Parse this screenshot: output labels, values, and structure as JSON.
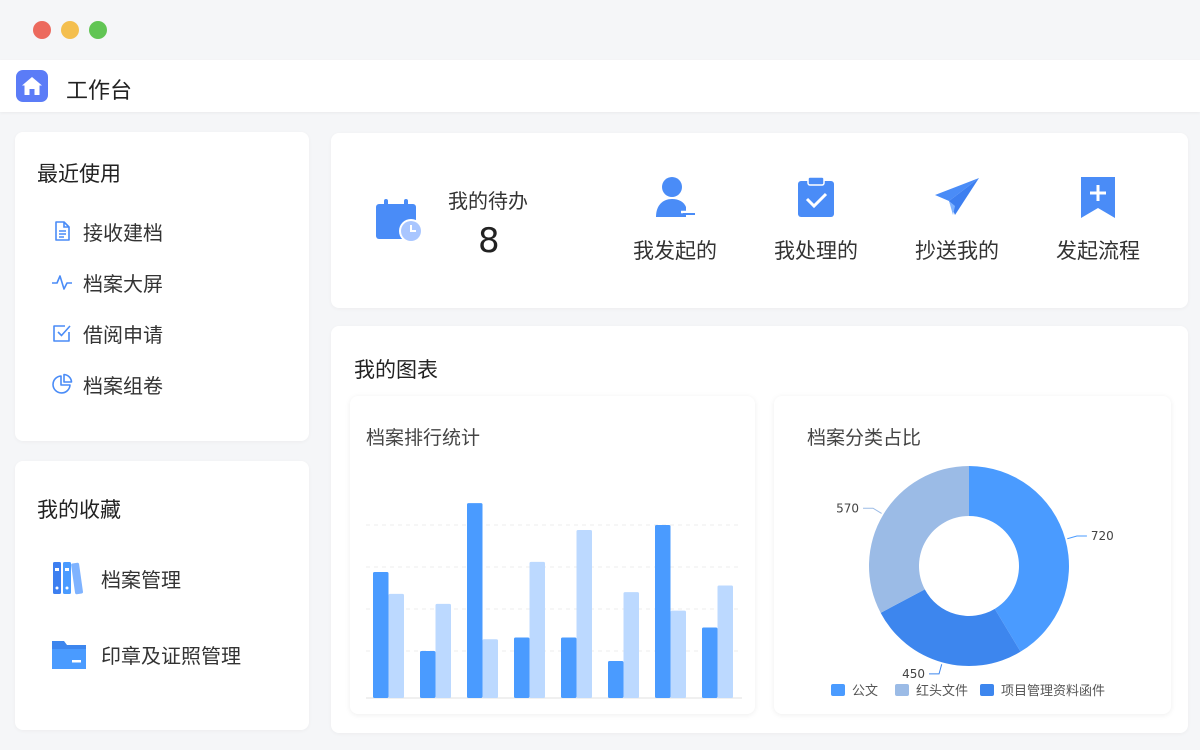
{
  "app": {
    "title": "工作台"
  },
  "recent": {
    "title": "最近使用",
    "items": [
      {
        "label": "接收建档",
        "icon": "document-icon"
      },
      {
        "label": "档案大屏",
        "icon": "pulse-icon"
      },
      {
        "label": "借阅申请",
        "icon": "checkbox-icon"
      },
      {
        "label": "档案组卷",
        "icon": "pie-icon"
      }
    ]
  },
  "favorites": {
    "title": "我的收藏",
    "items": [
      {
        "label": "档案管理",
        "icon": "binders-icon"
      },
      {
        "label": "印章及证照管理",
        "icon": "folder-icon"
      }
    ]
  },
  "todo": {
    "label": "我的待办",
    "count": "8",
    "actions": [
      {
        "label": "我发起的",
        "icon": "user-send-icon"
      },
      {
        "label": "我处理的",
        "icon": "clipboard-check-icon"
      },
      {
        "label": "抄送我的",
        "icon": "paper-plane-icon"
      },
      {
        "label": "发起流程",
        "icon": "bookmark-plus-icon"
      }
    ]
  },
  "charts": {
    "title": "我的图表",
    "accent": "#4a9bff",
    "accent_light": "#bcd9ff"
  },
  "chart_data": [
    {
      "type": "bar",
      "title": "档案排行统计",
      "categories": [
        "",
        "",
        "",
        "",
        "",
        "",
        "",
        ""
      ],
      "series": [
        {
          "values": [
            75,
            28,
            116,
            36,
            36,
            22,
            103,
            42
          ],
          "color": "#4a9bff"
        },
        {
          "values": [
            62,
            56,
            35,
            81,
            100,
            63,
            52,
            67
          ],
          "color": "#bcd9ff"
        }
      ],
      "ylim": [
        0,
        125
      ],
      "grid": true
    },
    {
      "type": "pie",
      "title": "档案分类占比",
      "donut": true,
      "slices": [
        {
          "name": "公文",
          "value": 720,
          "color": "#4a9bff"
        },
        {
          "name": "项目管理资料函件",
          "value": 450,
          "color": "#3d86ee"
        },
        {
          "name": "红头文件",
          "value": 570,
          "color": "#9bbbe6"
        }
      ],
      "legend": [
        "公文",
        "红头文件",
        "项目管理资料函件"
      ],
      "legend_placement": "bottom"
    }
  ]
}
